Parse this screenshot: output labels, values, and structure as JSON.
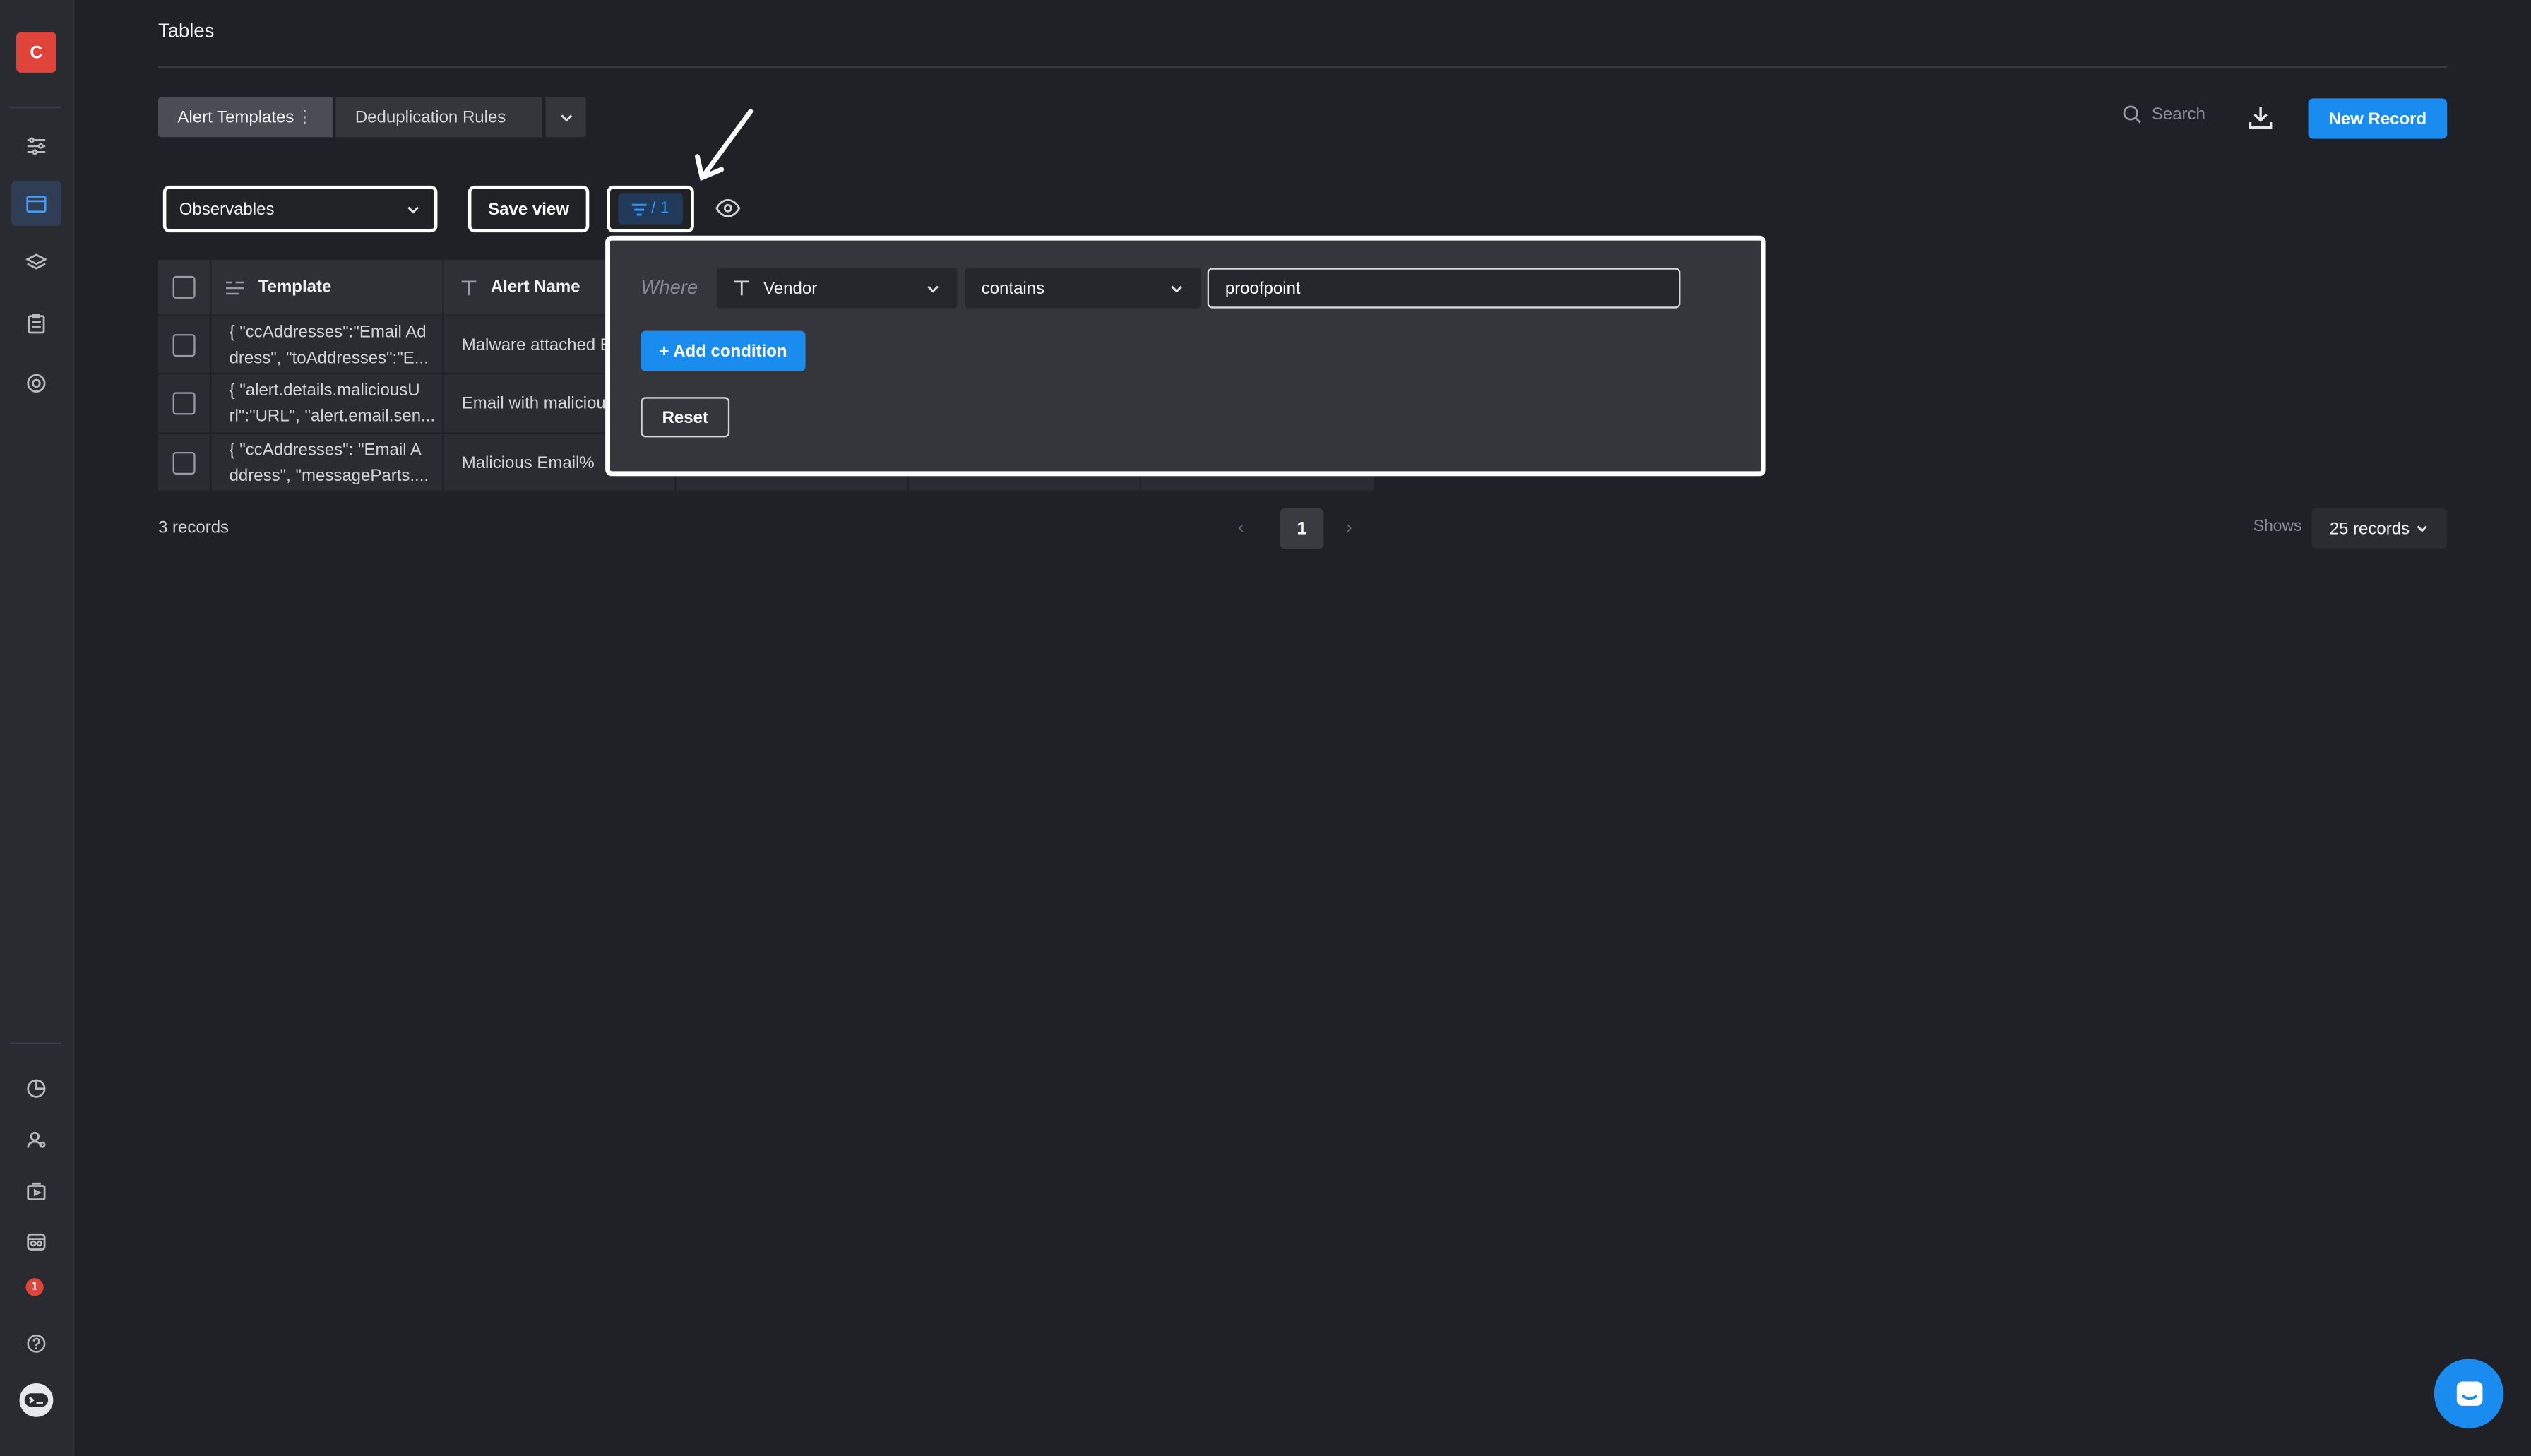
{
  "app": {
    "logo_letter": "C",
    "page_title": "Tables"
  },
  "tabs": [
    {
      "label": "Alert Templates",
      "menu_glyph": "⋮"
    },
    {
      "label": "Deduplication Rules"
    }
  ],
  "header": {
    "search_label": "Search",
    "new_record_label": "New Record"
  },
  "toolbar": {
    "view_label": "Observables",
    "save_view_label": "Save view",
    "filter_count": "/ 1"
  },
  "table": {
    "columns": [
      "Template",
      "Alert Name"
    ],
    "rows": [
      {
        "template": "{ \"ccAddresses\":\"Email Ad\ndress\", \"toAddresses\":\"E...",
        "alert_name": "Malware attached E"
      },
      {
        "template": "{ \"alert.details.maliciousU\nrl\":\"URL\", \"alert.email.sen...",
        "alert_name": "Email with maliciou"
      },
      {
        "template": "{ \"ccAddresses\": \"Email A\nddress\", \"messageParts....",
        "alert_name": "Malicious Email%"
      }
    ]
  },
  "filter": {
    "where_label": "Where",
    "field": "Vendor",
    "operator": "contains",
    "value": "proofpoint",
    "add_condition_label": "+ Add condition",
    "reset_label": "Reset"
  },
  "footer": {
    "record_count": "3 records",
    "prev_glyph": "‹",
    "current_page": "1",
    "next_glyph": "›",
    "shows_label": "Shows",
    "per_page": "25 records"
  },
  "sidebar": {
    "notification_count": "1",
    "icons_top": [
      "sliders-icon",
      "table-icon",
      "layers-icon",
      "clipboard-icon",
      "target-icon"
    ],
    "icons_bottom": [
      "chart-icon",
      "users-icon",
      "media-icon",
      "integrations-icon",
      "notifications-icon",
      "help-icon",
      "chat-bot-icon"
    ]
  },
  "colors": {
    "accent": "#1a8cf0",
    "logo": "#e0433a",
    "background": "#202127"
  }
}
